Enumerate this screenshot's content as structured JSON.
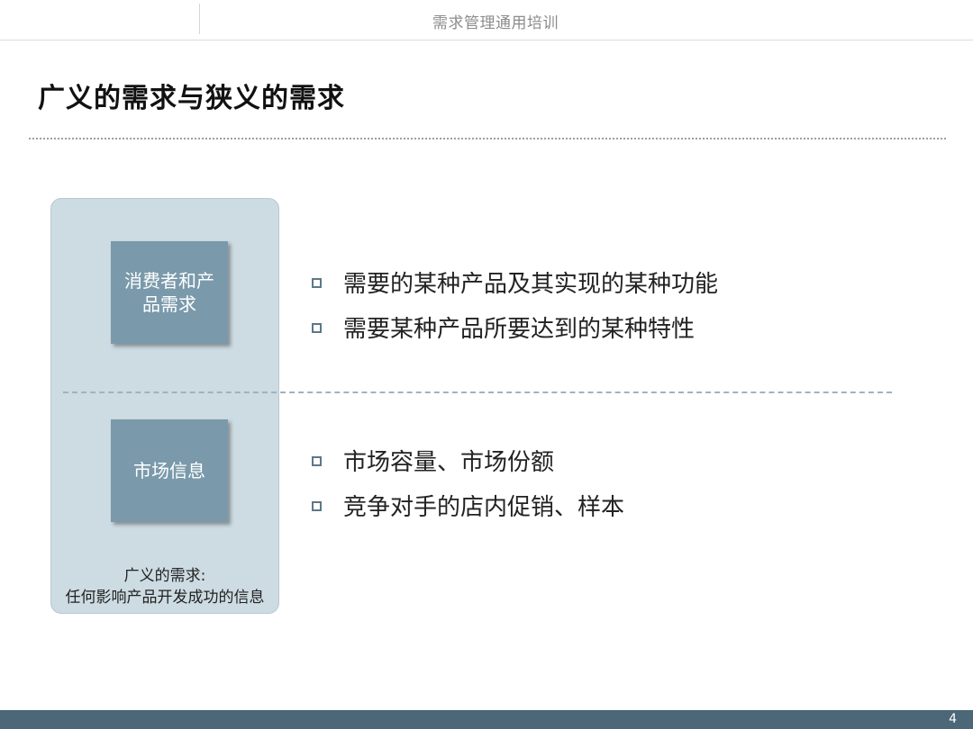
{
  "header": {
    "title": "需求管理通用培训"
  },
  "slide": {
    "title": "广义的需求与狭义的需求"
  },
  "categories": [
    {
      "label": "消费者和产品需求",
      "bullets": [
        "需要的某种产品及其实现的某种功能",
        "需要某种产品所要达到的某种特性"
      ]
    },
    {
      "label": "市场信息",
      "bullets": [
        "市场容量、市场份额",
        "竞争对手的店内促销、样本"
      ]
    }
  ],
  "panel": {
    "caption_line1": "广义的需求:",
    "caption_line2": "任何影响产品开发成功的信息"
  },
  "footer": {
    "page_number": "4"
  },
  "colors": {
    "panel_bg": "#cddbe2",
    "box_bg": "#7a9aab",
    "footer_bg": "#4b6778"
  }
}
